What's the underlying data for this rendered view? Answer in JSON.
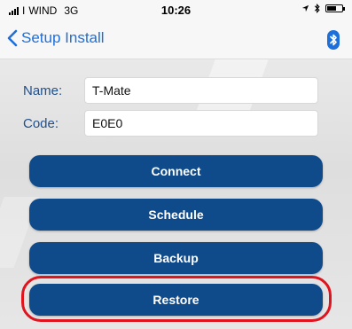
{
  "status_bar": {
    "carrier": "WIND",
    "network": "3G",
    "time": "10:26"
  },
  "nav": {
    "back_label": "Setup Install",
    "bluetooth_icon": "bluetooth-icon"
  },
  "form": {
    "name_label": "Name:",
    "name_value": "T-Mate",
    "code_label": "Code:",
    "code_value": "E0E0"
  },
  "actions": [
    {
      "label": "Connect"
    },
    {
      "label": "Schedule"
    },
    {
      "label": "Backup"
    },
    {
      "label": "Restore"
    }
  ],
  "colors": {
    "button_bg": "#0f4a8a",
    "label_color": "#1f4f8c",
    "highlight": "#e0141e",
    "ios_blue": "#1e6fd9"
  }
}
